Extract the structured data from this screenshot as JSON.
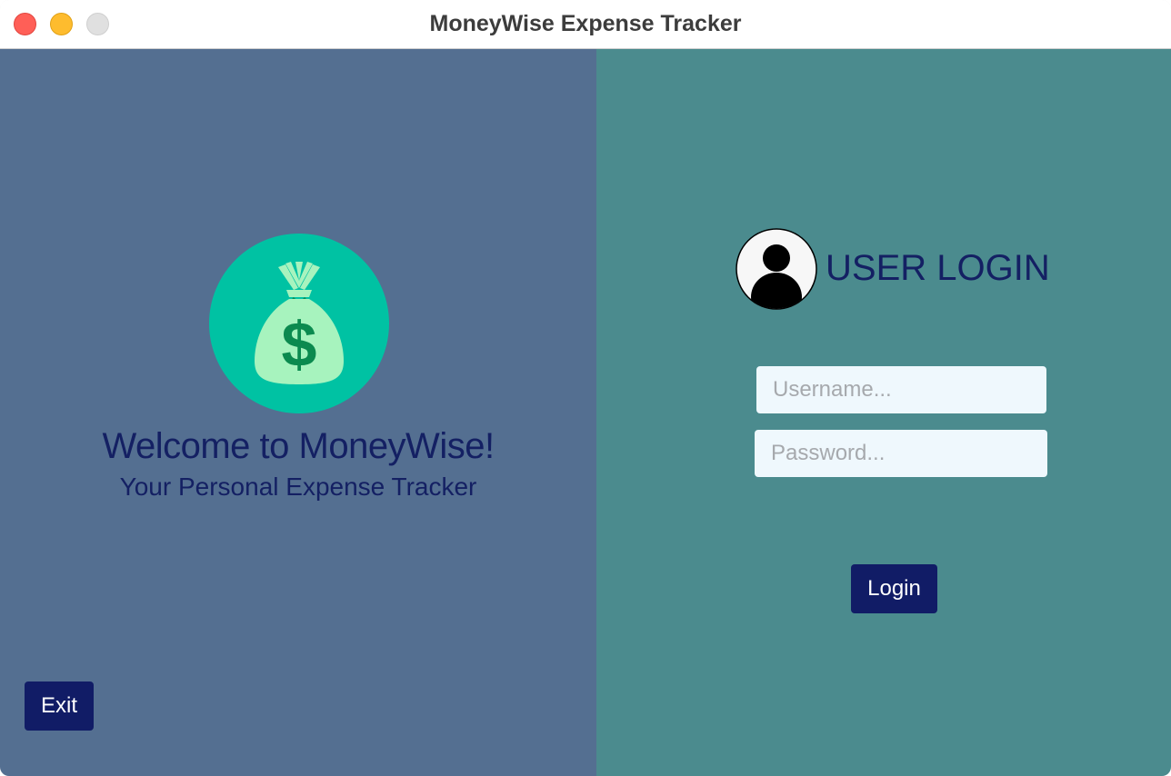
{
  "window": {
    "title": "MoneyWise Expense Tracker"
  },
  "left_panel": {
    "logo_icon": "money-bag-icon",
    "welcome_text": "Welcome to MoneyWise!",
    "tagline": "Your Personal Expense Tracker",
    "exit_label": "Exit"
  },
  "login": {
    "avatar_icon": "user-avatar-icon",
    "title": "USER LOGIN",
    "username_placeholder": "Username...",
    "password_placeholder": "Password...",
    "username_value": "",
    "password_value": "",
    "login_label": "Login"
  },
  "colors": {
    "left_panel_bg": "#546f91",
    "right_panel_bg": "#4b8b8e",
    "heading_text": "#142063",
    "button_bg": "#111c66",
    "field_bg": "#eff8fd",
    "logo_circle": "#00c2a3",
    "bag_fill": "#a7f3be",
    "dollar": "#0b8a4f"
  }
}
